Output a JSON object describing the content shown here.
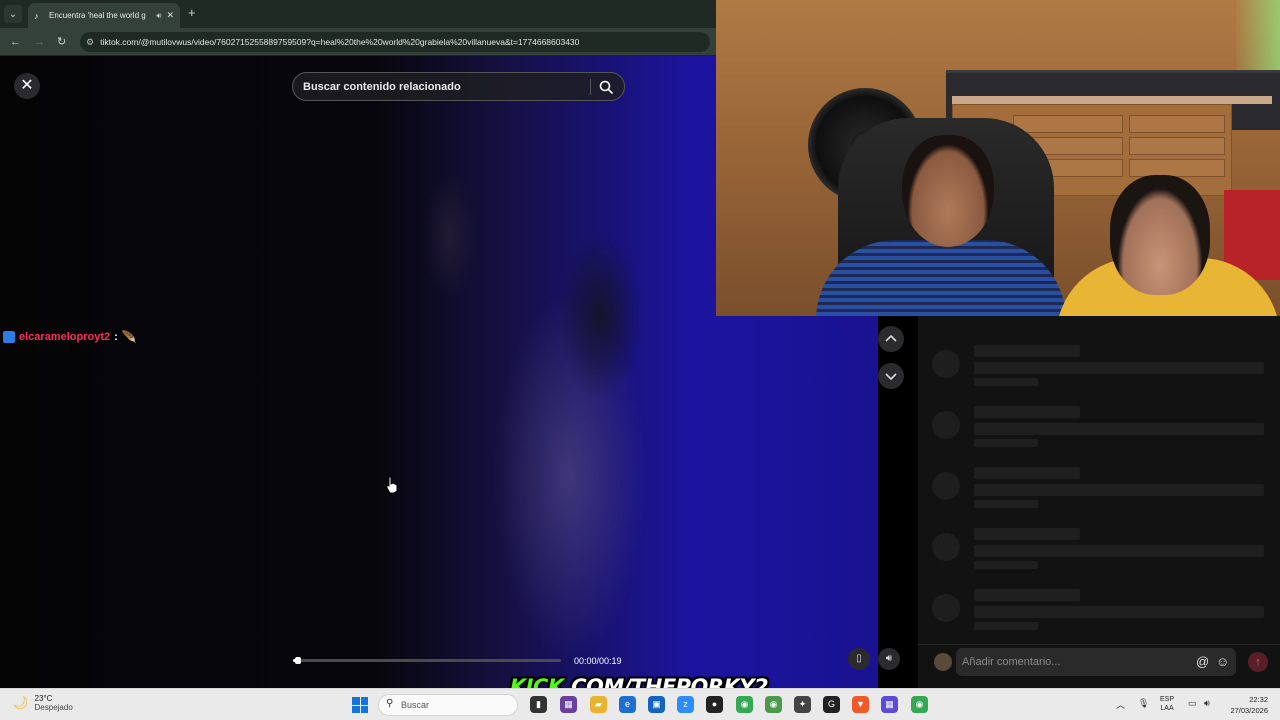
{
  "browser": {
    "tab": {
      "title": "Encuentra 'heal the world g",
      "favicon": "tiktok-icon"
    },
    "url": "tiktok.com/@mutilovwus/video/7602715255889759509?q=heal%20the%20world%20grabiela%20villanueva&t=1774668603430"
  },
  "viewer": {
    "search_placeholder": "Buscar contenido relacionado",
    "time": "00:00/00:19",
    "progress": 0.02
  },
  "chat": {
    "username": "elcarameloproyt2",
    "separator": ":",
    "emote": "🪶"
  },
  "comments": {
    "placeholder": "Añadir comentario...",
    "at_icon": "@",
    "emoji_icon": "☺"
  },
  "overlay": {
    "kick_prefix": "KICK",
    "kick_rest": ".COM/THEPORKY2"
  },
  "taskbar": {
    "temp": "23°C",
    "condition": "Despejado",
    "search_label": "Buscar",
    "lang_top": "ESP",
    "lang_bottom": "LAA",
    "time": "22:32",
    "date": "27/03/2026"
  },
  "colors": {
    "username": "#ff2d55",
    "kick_green": "#53fc18",
    "send": "#5a1e28"
  }
}
